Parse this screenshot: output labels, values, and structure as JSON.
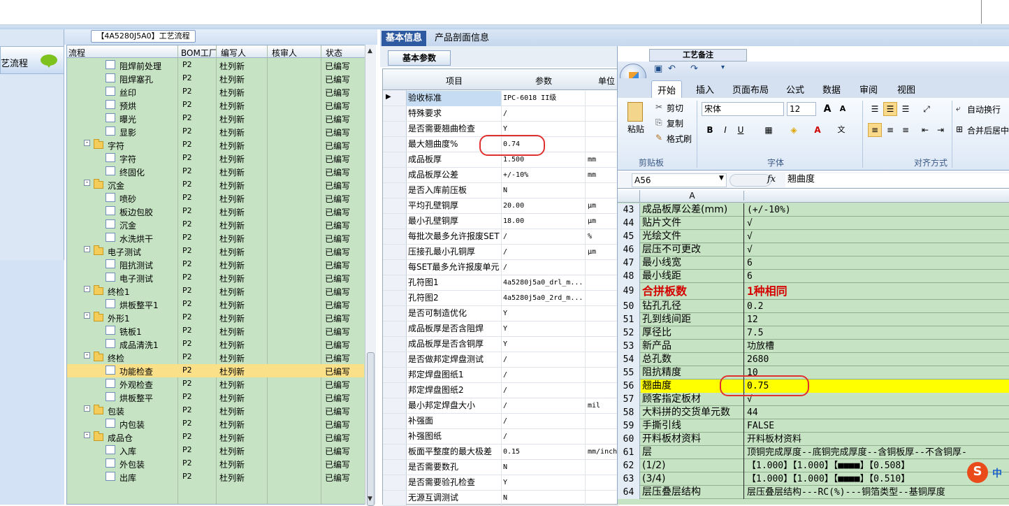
{
  "workflow": {
    "title": "【4A5280J5A0】工艺流程",
    "nav_label": "艺流程",
    "columns": [
      "流程",
      "BOM工厂",
      "编写人",
      "核审人",
      "状态"
    ],
    "rows": [
      {
        "name": "阻焊前处理",
        "level": 2,
        "type": "doc",
        "bom": "P2",
        "author": "杜列新",
        "status": "已编写"
      },
      {
        "name": "阻焊塞孔",
        "level": 2,
        "type": "doc",
        "bom": "P2",
        "author": "杜列新",
        "status": "已编写"
      },
      {
        "name": "丝印",
        "level": 2,
        "type": "doc",
        "bom": "P2",
        "author": "杜列新",
        "status": "已编写"
      },
      {
        "name": "预烘",
        "level": 2,
        "type": "doc",
        "bom": "P2",
        "author": "杜列新",
        "status": "已编写"
      },
      {
        "name": "曝光",
        "level": 2,
        "type": "doc",
        "bom": "P2",
        "author": "杜列新",
        "status": "已编写"
      },
      {
        "name": "显影",
        "level": 2,
        "type": "doc",
        "bom": "P2",
        "author": "杜列新",
        "status": "已编写"
      },
      {
        "name": "字符",
        "level": 1,
        "type": "folder",
        "bom": "P2",
        "author": "杜列新",
        "status": "已编写"
      },
      {
        "name": "字符",
        "level": 2,
        "type": "doc",
        "bom": "P2",
        "author": "杜列新",
        "status": "已编写"
      },
      {
        "name": "终固化",
        "level": 2,
        "type": "doc",
        "bom": "P2",
        "author": "杜列新",
        "status": "已编写"
      },
      {
        "name": "沉金",
        "level": 1,
        "type": "folder",
        "bom": "P2",
        "author": "杜列新",
        "status": "已编写"
      },
      {
        "name": "喷砂",
        "level": 2,
        "type": "doc",
        "bom": "P2",
        "author": "杜列新",
        "status": "已编写"
      },
      {
        "name": "板边包胶",
        "level": 2,
        "type": "doc",
        "bom": "P2",
        "author": "杜列新",
        "status": "已编写"
      },
      {
        "name": "沉金",
        "level": 2,
        "type": "doc",
        "bom": "P2",
        "author": "杜列新",
        "status": "已编写"
      },
      {
        "name": "水洗烘干",
        "level": 2,
        "type": "doc",
        "bom": "P2",
        "author": "杜列新",
        "status": "已编写"
      },
      {
        "name": "电子测试",
        "level": 1,
        "type": "folder",
        "bom": "P2",
        "author": "杜列新",
        "status": "已编写"
      },
      {
        "name": "阻抗测试",
        "level": 2,
        "type": "doc",
        "bom": "P2",
        "author": "杜列新",
        "status": "已编写"
      },
      {
        "name": "电子测试",
        "level": 2,
        "type": "doc",
        "bom": "P2",
        "author": "杜列新",
        "status": "已编写"
      },
      {
        "name": "终检1",
        "level": 1,
        "type": "folder",
        "bom": "P2",
        "author": "杜列新",
        "status": "已编写"
      },
      {
        "name": "烘板整平1",
        "level": 2,
        "type": "doc",
        "bom": "P2",
        "author": "杜列新",
        "status": "已编写"
      },
      {
        "name": "外形1",
        "level": 1,
        "type": "folder",
        "bom": "P2",
        "author": "杜列新",
        "status": "已编写"
      },
      {
        "name": "铣板1",
        "level": 2,
        "type": "doc",
        "bom": "P2",
        "author": "杜列新",
        "status": "已编写"
      },
      {
        "name": "成品清洗1",
        "level": 2,
        "type": "doc",
        "bom": "P2",
        "author": "杜列新",
        "status": "已编写"
      },
      {
        "name": "终检",
        "level": 1,
        "type": "folder",
        "bom": "P2",
        "author": "杜列新",
        "status": "已编写"
      },
      {
        "name": "功能检查",
        "level": 2,
        "type": "doc",
        "bom": "P2",
        "author": "杜列新",
        "status": "已编写",
        "selected": true
      },
      {
        "name": "外观检查",
        "level": 2,
        "type": "doc",
        "bom": "P2",
        "author": "杜列新",
        "status": "已编写"
      },
      {
        "name": "烘板整平",
        "level": 2,
        "type": "doc",
        "bom": "P2",
        "author": "杜列新",
        "status": "已编写"
      },
      {
        "name": "包装",
        "level": 1,
        "type": "folder",
        "bom": "P2",
        "author": "杜列新",
        "status": "已编写"
      },
      {
        "name": "内包装",
        "level": 2,
        "type": "doc",
        "bom": "P2",
        "author": "杜列新",
        "status": "已编写"
      },
      {
        "name": "成品仓",
        "level": 1,
        "type": "folder",
        "bom": "P2",
        "author": "杜列新",
        "status": "已编写"
      },
      {
        "name": "入库",
        "level": 2,
        "type": "doc",
        "bom": "P2",
        "author": "杜列新",
        "status": "已编写"
      },
      {
        "name": "外包装",
        "level": 2,
        "type": "doc",
        "bom": "P2",
        "author": "杜列新",
        "status": "已编写"
      },
      {
        "name": "出库",
        "level": 2,
        "type": "doc",
        "bom": "P2",
        "author": "杜列新",
        "status": "已编写"
      }
    ]
  },
  "middle": {
    "tabs": [
      "基本信息",
      "产品剖面信息"
    ],
    "subtab": "基本参数",
    "columns": [
      "项目",
      "参数",
      "单位"
    ],
    "rows": [
      {
        "item": "验收标准",
        "param": "IPC-6018 II级",
        "unit": "",
        "current": true
      },
      {
        "item": "特殊要求",
        "param": "/",
        "unit": ""
      },
      {
        "item": "是否需要翘曲检查",
        "param": "Y",
        "unit": ""
      },
      {
        "item": "最大翘曲度%",
        "param": "0.74",
        "unit": ""
      },
      {
        "item": "成品板厚",
        "param": "1.500",
        "unit": "mm"
      },
      {
        "item": "成品板厚公差",
        "param": "+/-10%",
        "unit": "mm"
      },
      {
        "item": "是否入库前压板",
        "param": "N",
        "unit": ""
      },
      {
        "item": "平均孔壁铜厚",
        "param": "20.00",
        "unit": "μm"
      },
      {
        "item": "最小孔壁铜厚",
        "param": "18.00",
        "unit": "μm"
      },
      {
        "item": "每批次最多允许报废SET",
        "param": "/",
        "unit": "%"
      },
      {
        "item": "压接孔最小孔铜厚",
        "param": "/",
        "unit": "μm"
      },
      {
        "item": "每SET最多允许报废单元",
        "param": "/",
        "unit": ""
      },
      {
        "item": "孔符图1",
        "param": "4a5280j5a0_drl_m...",
        "unit": ""
      },
      {
        "item": "孔符图2",
        "param": "4a5280j5a0_2rd_m...",
        "unit": ""
      },
      {
        "item": "是否可制造优化",
        "param": "Y",
        "unit": ""
      },
      {
        "item": "成品板厚是否含阻焊",
        "param": "Y",
        "unit": ""
      },
      {
        "item": "成品板厚是否含铜厚",
        "param": "Y",
        "unit": ""
      },
      {
        "item": "是否做邦定焊盘测试",
        "param": "/",
        "unit": ""
      },
      {
        "item": "邦定焊盘图纸1",
        "param": "/",
        "unit": ""
      },
      {
        "item": "邦定焊盘图纸2",
        "param": "/",
        "unit": ""
      },
      {
        "item": "最小邦定焊盘大小",
        "param": "/",
        "unit": "mil"
      },
      {
        "item": "补强面",
        "param": "/",
        "unit": ""
      },
      {
        "item": "补强图纸",
        "param": "/",
        "unit": ""
      },
      {
        "item": "板面平整度的最大极差",
        "param": "0.15",
        "unit": "mm/inch"
      },
      {
        "item": "是否需要数孔",
        "param": "N",
        "unit": ""
      },
      {
        "item": "是否需要验孔检查",
        "param": "Y",
        "unit": ""
      },
      {
        "item": "无源互调测试",
        "param": "N",
        "unit": ""
      }
    ]
  },
  "excel": {
    "behind_tab": "工艺备注",
    "ribbon_tabs": [
      "开始",
      "插入",
      "页面布局",
      "公式",
      "数据",
      "审阅",
      "视图"
    ],
    "clipboard": {
      "paste": "粘贴",
      "cut": "剪切",
      "copy": "复制",
      "format_painter": "格式刷",
      "group": "剪贴板"
    },
    "font": {
      "name": "宋体",
      "size": "12",
      "group": "字体",
      "bold": "B",
      "italic": "I",
      "underline": "U",
      "grow": "A",
      "shrink": "A"
    },
    "align": {
      "wrap": "自动换行",
      "merge": "合并后居中",
      "group": "对齐方式"
    },
    "name_box": "A56",
    "fx": "fx",
    "formula": "翘曲度",
    "col_a": "A",
    "rows": [
      {
        "n": "43",
        "a": "成品板厚公差(mm)",
        "b": "(+/-10%)"
      },
      {
        "n": "44",
        "a": "贴片文件",
        "b": "√"
      },
      {
        "n": "45",
        "a": "光绘文件",
        "b": "√"
      },
      {
        "n": "46",
        "a": "层压不可更改",
        "b": "√"
      },
      {
        "n": "47",
        "a": "最小线宽",
        "b": "6"
      },
      {
        "n": "48",
        "a": "最小线距",
        "b": "6"
      },
      {
        "n": "49",
        "a": "合拼板数",
        "b": "1种相同",
        "big": true
      },
      {
        "n": "50",
        "a": "钻孔孔径",
        "b": "0.2"
      },
      {
        "n": "51",
        "a": "孔到线间距",
        "b": "12"
      },
      {
        "n": "52",
        "a": "厚径比",
        "b": "7.5"
      },
      {
        "n": "53",
        "a": "新产品",
        "b": "功放槽"
      },
      {
        "n": "54",
        "a": "总孔数",
        "b": "2680"
      },
      {
        "n": "55",
        "a": "阻抗精度",
        "b": "10"
      },
      {
        "n": "56",
        "a": "翘曲度",
        "b": "0.75",
        "hl": true
      },
      {
        "n": "57",
        "a": "顾客指定板材",
        "b": "√"
      },
      {
        "n": "58",
        "a": "大料拼的交货单元数",
        "b": "44"
      },
      {
        "n": "59",
        "a": "手撕引线",
        "b": "FALSE"
      },
      {
        "n": "60",
        "a": "开料板材资料",
        "b": "开料板材资料"
      },
      {
        "n": "61",
        "a": "层",
        "b": "顶铜完成厚度--底铜完成厚度--含铜板厚--不含铜厚-"
      },
      {
        "n": "62",
        "a": "(1/2)",
        "b": "【1.000】【1.000】【■■■■】【0.508】"
      },
      {
        "n": "63",
        "a": "(3/4)",
        "b": "【1.000】【1.000】【■■■■】【0.510】"
      },
      {
        "n": "64",
        "a": "层压叠层结构",
        "b": "层压叠层结构---RC(%)---铜箔类型--基铜厚度"
      }
    ]
  },
  "ime": {
    "label": "中"
  }
}
